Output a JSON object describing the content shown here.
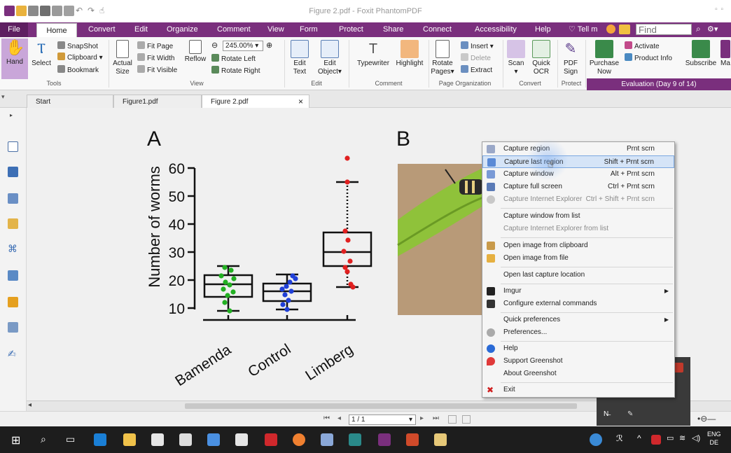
{
  "window": {
    "title": "Figure 2.pdf - Foxit PhantomPDF",
    "controls": "▫ ▫"
  },
  "menu": {
    "file": "File",
    "tabs": [
      "Home",
      "Convert",
      "Edit",
      "Organize",
      "Comment",
      "View",
      "Form",
      "Protect",
      "Share",
      "Connect",
      "Accessibility",
      "Help"
    ],
    "tell_me": "Tell m",
    "find_placeholder": "Find"
  },
  "ribbon": {
    "hand": "Hand",
    "select": "Select",
    "snapshot": "SnapShot",
    "clipboard": "Clipboard ▾",
    "bookmark": "Bookmark",
    "actual_size": [
      "Actual",
      "Size"
    ],
    "fit_page": "Fit Page",
    "fit_width": "Fit Width",
    "fit_visible": "Fit Visible",
    "reflow": "Reflow",
    "zoom": "245.00%",
    "rotate_left": "Rotate Left",
    "rotate_right": "Rotate Right",
    "edit_text": [
      "Edit",
      "Text"
    ],
    "edit_object": [
      "Edit",
      "Object▾"
    ],
    "typewriter": "Typewriter",
    "highlight": "Highlight",
    "rotate_pages": [
      "Rotate",
      "Pages▾"
    ],
    "insert": "Insert ▾",
    "delete": "Delete",
    "extract": "Extract",
    "scan": "Scan",
    "quick_ocr": [
      "Quick",
      "OCR"
    ],
    "pdf_sign": [
      "PDF",
      "Sign"
    ],
    "purchase_now": [
      "Purchase",
      "Now"
    ],
    "activate": "Activate",
    "product_info": "Product Info",
    "subscribe": "Subscribe",
    "ma": "Ma",
    "groups": [
      "Tools",
      "View",
      "Edit",
      "Comment",
      "Page Organization",
      "Convert",
      "Protect"
    ],
    "evaluation": "Evaluation (Day 9 of 14)"
  },
  "doc_tabs": [
    "Start",
    "Figure1.pdf",
    "Figure 2.pdf"
  ],
  "tab_close": "×",
  "figure": {
    "panel_a": "A",
    "panel_b": "B",
    "ylabel": "Number of worms",
    "yticks": [
      "60",
      "50",
      "40",
      "30",
      "20",
      "10"
    ],
    "categories": [
      "Bamenda",
      "Control",
      "Limberg"
    ]
  },
  "status": {
    "page": "1 / 1"
  },
  "context_menu": {
    "items": [
      {
        "label": "Capture region",
        "shortcut": "Prnt scrn",
        "disabled": false
      },
      {
        "label": "Capture last region",
        "shortcut": "Shift + Prnt scrn",
        "disabled": false
      },
      {
        "label": "Capture window",
        "shortcut": "Alt + Prnt scrn",
        "disabled": false
      },
      {
        "label": "Capture full screen",
        "shortcut": "Ctrl + Prnt scrn",
        "disabled": false
      },
      {
        "label": "Capture Internet Explorer",
        "shortcut": "Ctrl + Shift + Prnt scrn",
        "disabled": true
      },
      {
        "label": "Capture window from list",
        "shortcut": "",
        "disabled": false
      },
      {
        "label": "Capture Internet Explorer from list",
        "shortcut": "",
        "disabled": true
      },
      {
        "label": "Open image from clipboard",
        "shortcut": "",
        "disabled": false
      },
      {
        "label": "Open image from file",
        "shortcut": "",
        "disabled": false
      },
      {
        "label": "Open last capture location",
        "shortcut": "",
        "disabled": false
      },
      {
        "label": "Imgur",
        "shortcut": "",
        "disabled": false
      },
      {
        "label": "Configure external commands",
        "shortcut": "",
        "disabled": false
      },
      {
        "label": "Quick preferences",
        "shortcut": "",
        "disabled": false
      },
      {
        "label": "Preferences...",
        "shortcut": "",
        "disabled": false
      },
      {
        "label": "Help",
        "shortcut": "",
        "disabled": false
      },
      {
        "label": "Support Greenshot",
        "shortcut": "",
        "disabled": false
      },
      {
        "label": "About Greenshot",
        "shortcut": "",
        "disabled": false
      },
      {
        "label": "Exit",
        "shortcut": "",
        "disabled": false
      }
    ]
  },
  "tray": {
    "lang": "ENG",
    "region": "DE"
  },
  "colors": {
    "accent": "#7a2f7d",
    "menu_highlight": "#d5e4f7"
  }
}
